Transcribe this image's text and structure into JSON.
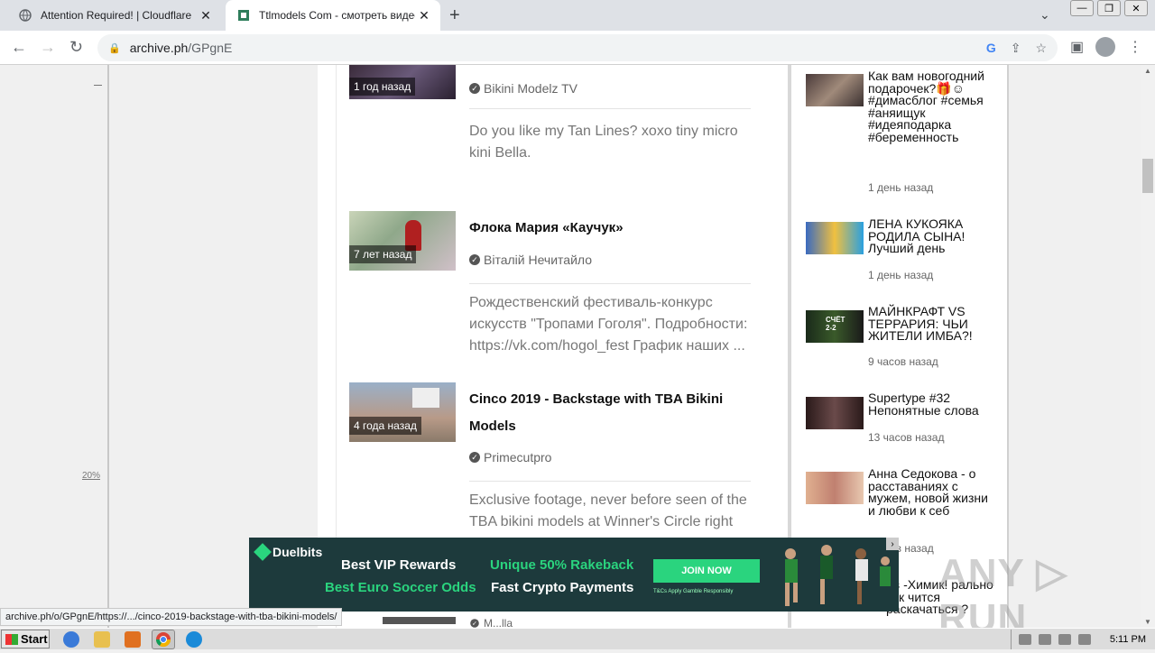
{
  "browser": {
    "tabs": [
      {
        "title": "Attention Required! | Cloudflare",
        "icon": "globe-icon"
      },
      {
        "title": "Ttlmodels Com - смотреть видео он",
        "icon": "page-icon"
      }
    ],
    "url_host": "archive.ph",
    "url_path": "/GPgnE",
    "status_url": "archive.ph/o/GPgnE/https://.../cinco-2019-backstage-with-tba-bikini-models/"
  },
  "page": {
    "left_percent": "20%",
    "videos": [
      {
        "ago": "1 год назад",
        "title": "",
        "channel": "Bikini Modelz TV",
        "desc": "Do you like my Tan Lines? xoxo tiny micro kini Bella."
      },
      {
        "ago": "7 лет назад",
        "title": "Флока Мария «Каучук»",
        "channel": "Віталій Нечитайло",
        "desc": "Рождественский фестиваль-конкурс искусств \"Тропами Гоголя\". Подробности: https://vk.com/hogol_fest График наших ..."
      },
      {
        "ago": "4 года назад",
        "title": "Cinco 2019 - Backstage with TBA Bikini Models",
        "channel": "Primecutpro",
        "desc": "Exclusive footage, never before seen of the TBA bikini models at Winner's Circle right"
      }
    ],
    "last_channel_partial": "M...lla",
    "sidebar": [
      {
        "title": "Как вам новогодний подарочек?🎁☺ #димасблог #семья #аняищук #идеяподарка #беременность",
        "ago": "1 день назад"
      },
      {
        "title": "ЛЕНА КУКОЯКА РОДИЛА СЫНА! Лучший день",
        "ago": "1 день назад"
      },
      {
        "title": "МАЙНКРАФТ VS ТЕРРАРИЯ: ЧЬИ ЖИТЕЛИ ИМБА?!",
        "ago": "9 часов назад"
      },
      {
        "title": "Supertype #32 Непонятные слова",
        "ago": "13 часов назад"
      },
      {
        "title": "Анна Седокова - о расставаниях с мужем, новой жизни и любви к себ",
        "ago": "ов назад"
      },
      {
        "title": "ев -Химик! рально так чится раскачаться ?",
        "ago": ""
      }
    ]
  },
  "ad": {
    "brand": "Duelbits",
    "line1a": "Best VIP Rewards",
    "line1b": "Unique 50% Rakeback",
    "line2a": "Best Euro Soccer Odds",
    "line2b": "Fast Crypto Payments",
    "button": "JOIN NOW",
    "fine": "T&Cs Apply  Gamble Responsibly"
  },
  "taskbar": {
    "start": "Start",
    "clock": "5:11 PM"
  },
  "watermark": "ANY ▷ RUN",
  "colors": {
    "ad_bg": "#1d3a3c",
    "ad_green": "#2ad47e"
  }
}
